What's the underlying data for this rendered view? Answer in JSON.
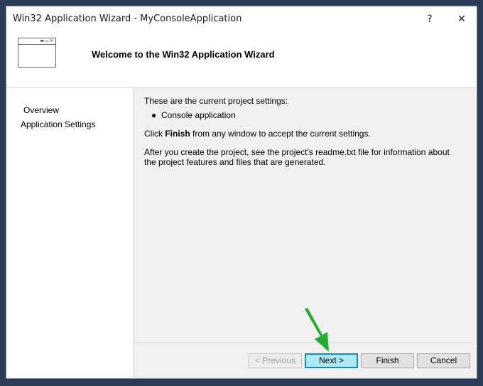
{
  "window": {
    "title": "Win32 Application Wizard - MyConsoleApplication",
    "help_label": "?",
    "close_label": "✕"
  },
  "header": {
    "title": "Welcome to the Win32 Application Wizard"
  },
  "sidebar": {
    "items": [
      {
        "label": "Overview",
        "selected": true
      },
      {
        "label": "Application Settings",
        "selected": false
      }
    ]
  },
  "main": {
    "intro": "These are the current project settings:",
    "bullets": [
      "Console application"
    ],
    "finish_prefix": "Click ",
    "finish_bold": "Finish",
    "finish_suffix": " from any window to accept the current settings.",
    "after_text": "After you create the project, see the project's readme.txt file for information about the project features and files that are generated."
  },
  "buttons": {
    "previous": "< Previous",
    "next": "Next >",
    "finish": "Finish",
    "cancel": "Cancel"
  },
  "annotation": {
    "arrow_color": "#1fae2e"
  }
}
